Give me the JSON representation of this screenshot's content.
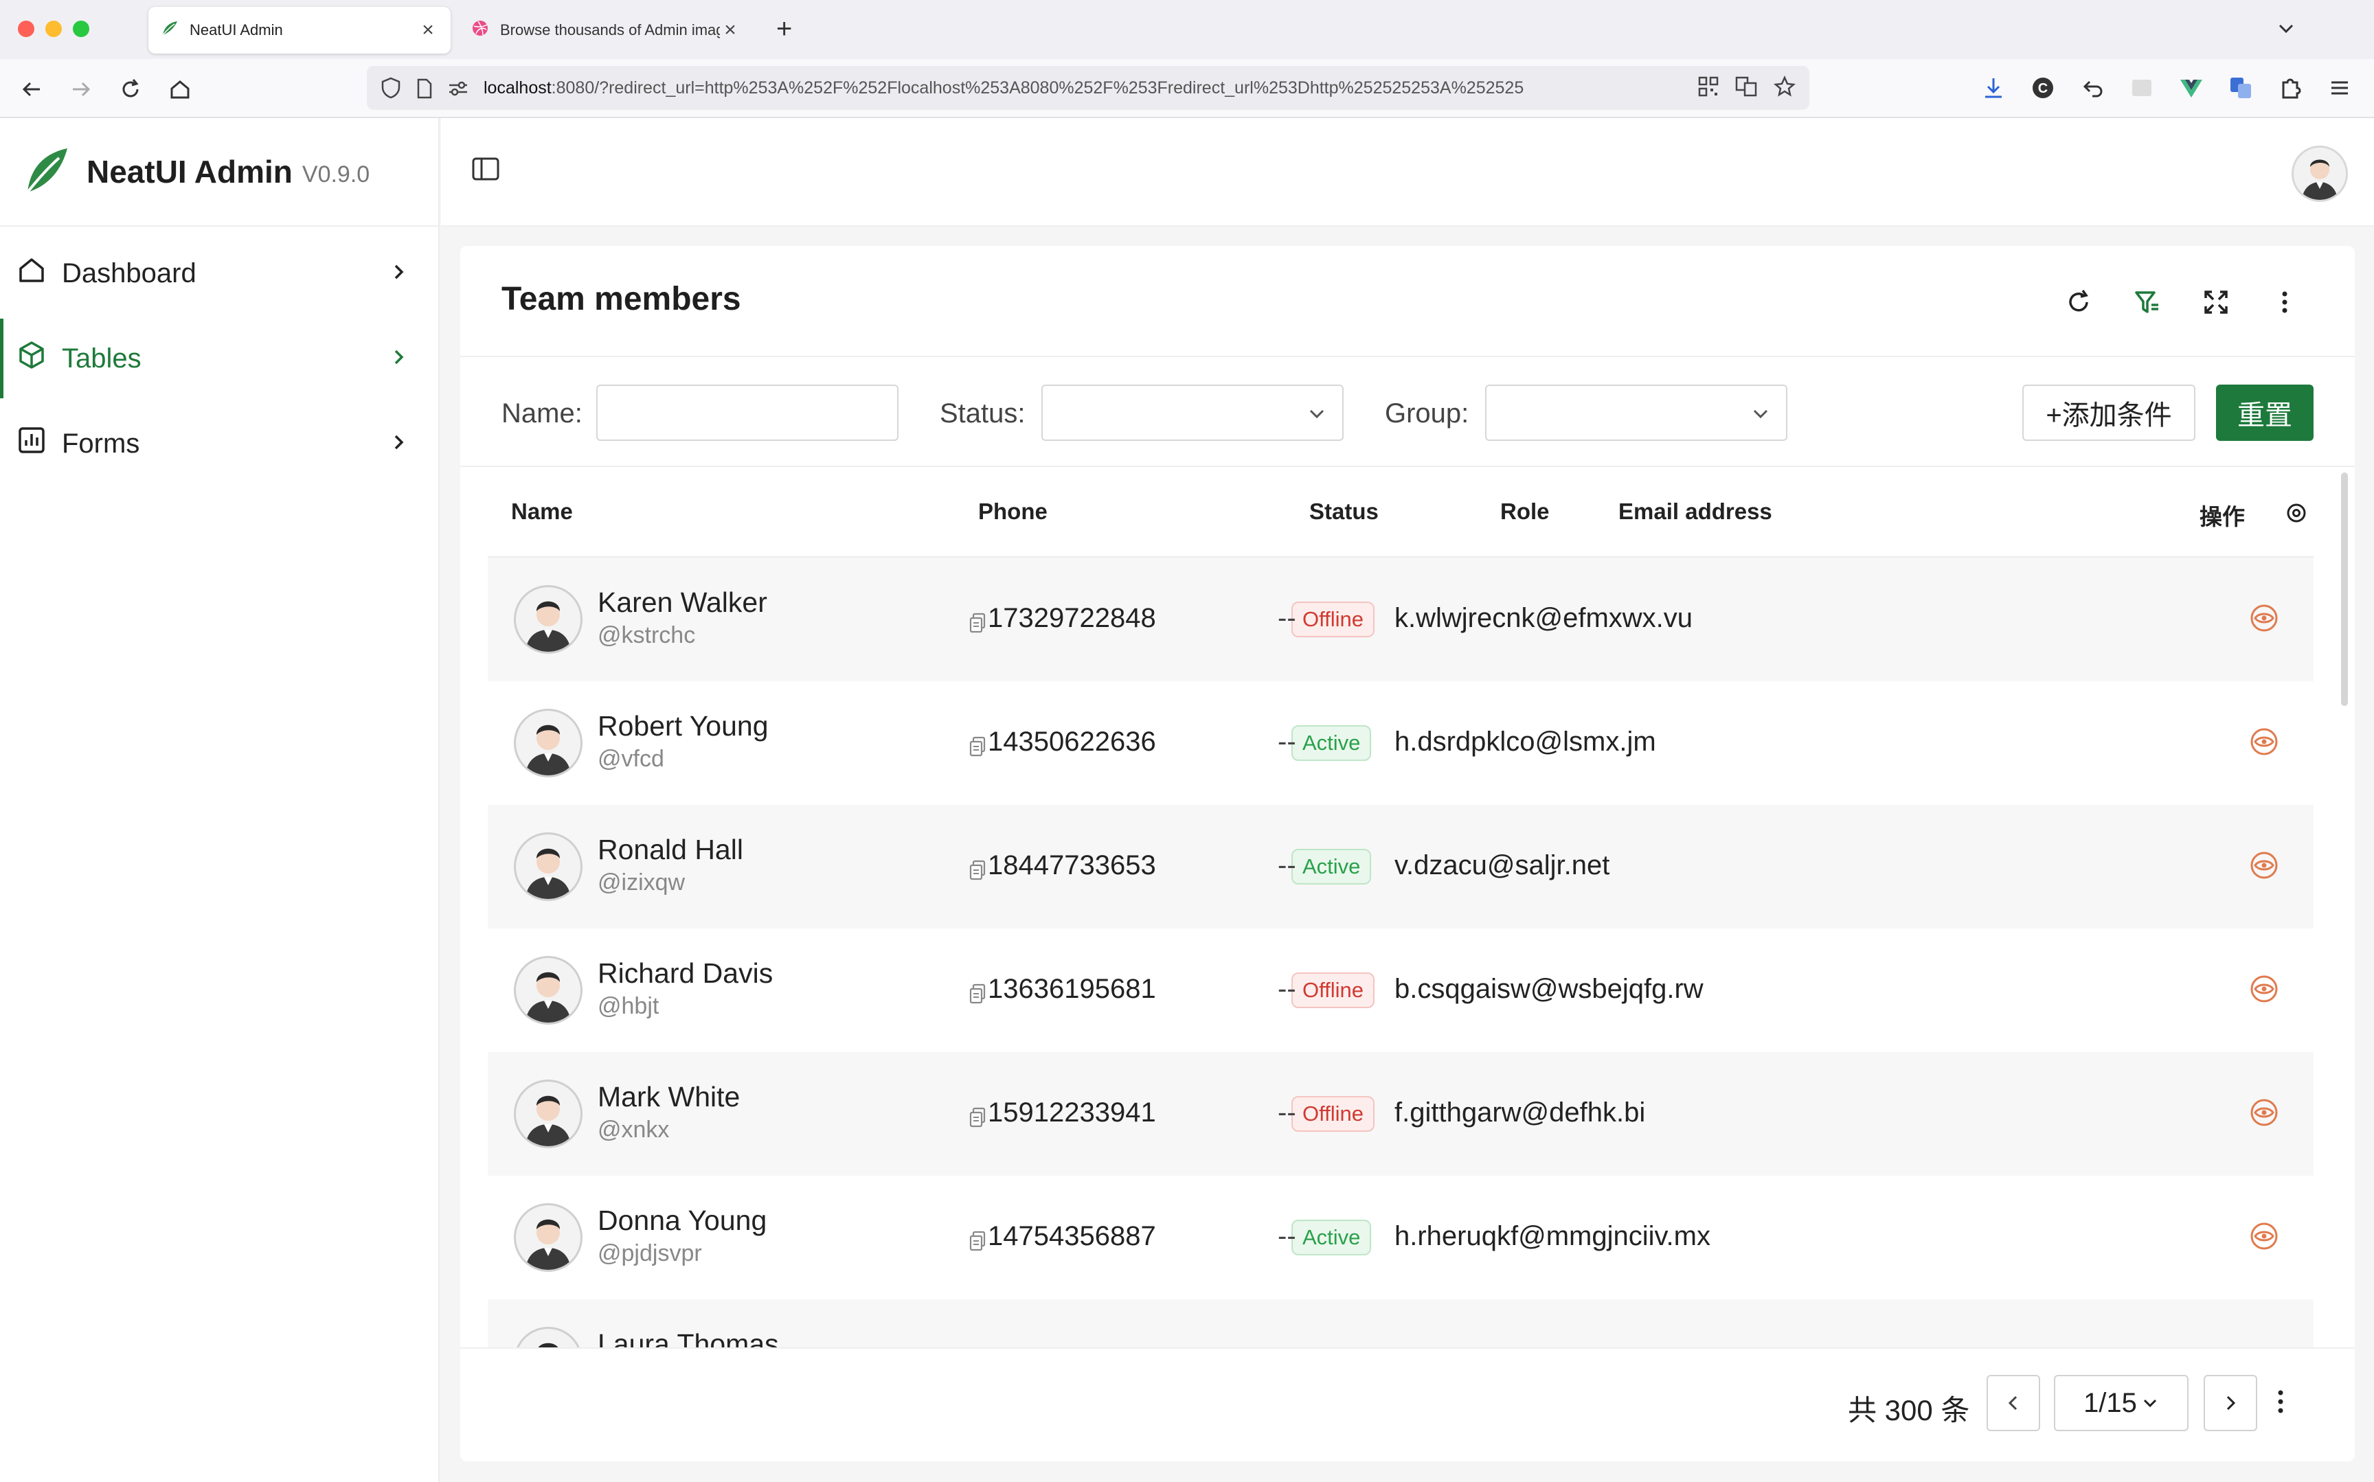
{
  "browser": {
    "tabs": [
      {
        "label": "NeatUI Admin"
      },
      {
        "label": "Browse thousands of Admin images"
      }
    ],
    "url_host": "localhost",
    "url_rest": ":8080/?redirect_url=http%253A%252F%252Flocalhost%253A8080%252F%253Fredirect_url%253Dhttp%252525253A%252525"
  },
  "app": {
    "brand_name": "NeatUI Admin",
    "brand_version": "V0.9.0"
  },
  "sidebar": {
    "items": [
      {
        "label": "Dashboard",
        "icon": "home-icon"
      },
      {
        "label": "Tables",
        "icon": "cube-icon",
        "active": true
      },
      {
        "label": "Forms",
        "icon": "bar-chart-icon"
      }
    ]
  },
  "card": {
    "title": "Team members"
  },
  "filters": {
    "name_label": "Name:",
    "name_value": "",
    "status_label": "Status:",
    "status_value": "",
    "group_label": "Group:",
    "group_value": "",
    "add_condition_label": "+添加条件",
    "reset_label": "重置"
  },
  "table": {
    "columns": {
      "name": "Name",
      "phone": "Phone",
      "status": "Status",
      "role": "Role",
      "email": "Email address",
      "actions": "操作"
    },
    "rows": [
      {
        "name": "Karen Walker",
        "handle": "@kstrchc",
        "phone": "17329722848",
        "status": "Offline",
        "role": "--",
        "email": "k.wlwjrecnk@efmxwx.vu"
      },
      {
        "name": "Robert Young",
        "handle": "@vfcd",
        "phone": "14350622636",
        "status": "Active",
        "role": "--",
        "email": "h.dsrdpklco@lsmx.jm"
      },
      {
        "name": "Ronald Hall",
        "handle": "@izixqw",
        "phone": "18447733653",
        "status": "Active",
        "role": "--",
        "email": "v.dzacu@saljr.net"
      },
      {
        "name": "Richard Davis",
        "handle": "@hbjt",
        "phone": "13636195681",
        "status": "Offline",
        "role": "--",
        "email": "b.csqgaisw@wsbejqfg.rw"
      },
      {
        "name": "Mark White",
        "handle": "@xnkx",
        "phone": "15912233941",
        "status": "Offline",
        "role": "--",
        "email": "f.gitthgarw@defhk.bi"
      },
      {
        "name": "Donna Young",
        "handle": "@pjdjsvpr",
        "phone": "14754356887",
        "status": "Active",
        "role": "--",
        "email": "h.rheruqkf@mmgjnciiv.mx"
      },
      {
        "name": "Laura Thomas",
        "handle": "",
        "phone": "",
        "status": "",
        "role": "",
        "email": ""
      }
    ]
  },
  "pagination": {
    "total_text": "共 300 条",
    "page_text": "1/15"
  },
  "colors": {
    "primary": "#1e7a3c",
    "offline": "#d03a31",
    "active": "#29a14a",
    "action_eye": "#e07b4f"
  }
}
